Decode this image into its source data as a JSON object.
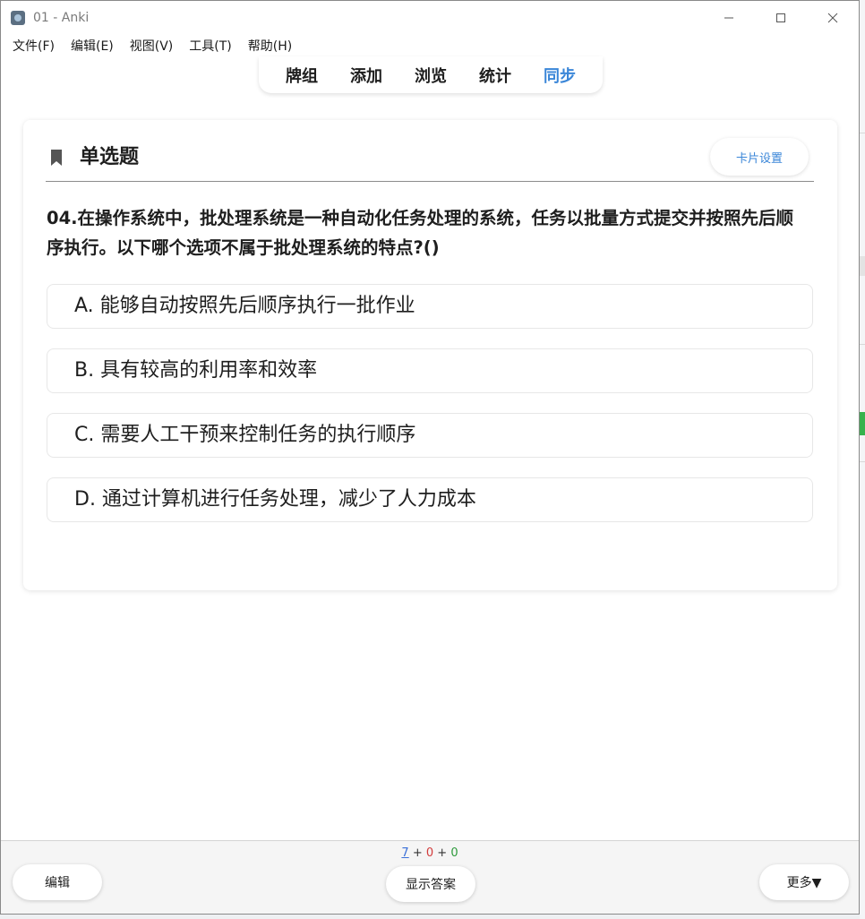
{
  "window": {
    "title": "01 - Anki",
    "controls": {
      "minimize": "—",
      "maximize": "☐",
      "close": "✕"
    }
  },
  "menu": [
    "文件(F)",
    "编辑(E)",
    "视图(V)",
    "工具(T)",
    "帮助(H)"
  ],
  "nav": {
    "items": [
      "牌组",
      "添加",
      "浏览",
      "统计",
      "同步"
    ],
    "active_index": 4
  },
  "card": {
    "type_label": "单选题",
    "icon": "bookmark-icon",
    "settings_label": "卡片设置",
    "question": "04.在操作系统中，批处理系统是一种自动化任务处理的系统，任务以批量方式提交并按照先后顺序执行。以下哪个选项不属于批处理系统的特点?()",
    "options": [
      "A. 能够自动按照先后顺序执行一批作业",
      "B. 具有较高的利用率和效率",
      "C. 需要人工干预来控制任务的执行顺序",
      "D. 通过计算机进行任务处理，减少了人力成本"
    ]
  },
  "bottom": {
    "counts": {
      "new": "7",
      "learn": "0",
      "review": "0",
      "sep": "+"
    },
    "edit_label": "编辑",
    "show_answer_label": "显示答案",
    "more_label": "更多▼"
  },
  "colors": {
    "accent": "#3a86d8",
    "new": "#3a6fd8",
    "learn": "#d23b3b",
    "review": "#2e9a3c"
  }
}
